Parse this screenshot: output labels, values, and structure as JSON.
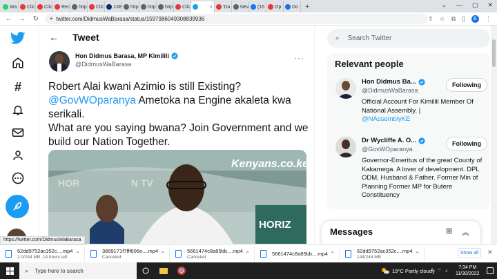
{
  "browser": {
    "tabs": [
      {
        "label": "Wa",
        "color": "#25d366"
      },
      {
        "label": "Clic",
        "color": "#e53935"
      },
      {
        "label": "Clic",
        "color": "#e53935"
      },
      {
        "label": "Rec",
        "color": "#e53935"
      },
      {
        "label": "http",
        "color": "#5f6368"
      },
      {
        "label": "Clic",
        "color": "#e53935"
      },
      {
        "label": "1XE",
        "color": "#0a2a6a"
      },
      {
        "label": "http",
        "color": "#5f6368"
      },
      {
        "label": "http",
        "color": "#5f6368"
      },
      {
        "label": "http",
        "color": "#5f6368"
      },
      {
        "label": "Clic",
        "color": "#e53935"
      },
      {
        "label": "",
        "color": "#1d9bf0",
        "active": true
      },
      {
        "label": "'Da",
        "color": "#e53935"
      },
      {
        "label": "Nev",
        "color": "#5f6368"
      },
      {
        "label": "(15",
        "color": "#1877f2"
      },
      {
        "label": "Op",
        "color": "#e53935"
      },
      {
        "label": "Do",
        "color": "#1a73e8"
      }
    ],
    "url": "twitter.com/DidmusWaBarasa/status/1597986049308839936",
    "profile_initial": "E",
    "status_url": "https://twitter.com/DidmusWaBarasa"
  },
  "tweet_header": {
    "title": "Tweet"
  },
  "author": {
    "name": "Hon Didmus Barasa, MP Kimilili",
    "handle": "@DidmusWaBarasa"
  },
  "tweet": {
    "line1": "Robert Alai kwani Azimio is still Existing?",
    "mention": "@GovWOparanya",
    "line2_rest": " Ametoka na Engine akaleta kwa serikali.",
    "line3": "What are you saying bwana? Join Government and we build our Nation Together.",
    "media_watermark": "Kenyans.co.ke",
    "media_banner1": "HOR",
    "media_banner2": "N TV",
    "media_banner3": "HORIZ"
  },
  "search": {
    "placeholder": "Search Twitter"
  },
  "relevant": {
    "title": "Relevant people",
    "people": [
      {
        "name": "Hon Didmus Ba...",
        "handle": "@DidmusWaBarasa",
        "follow": "Following",
        "bio": "Official Account For Kimilili Member Of National Assembly. |",
        "bio_link": "@NAssemblyKE"
      },
      {
        "name": "Dr Wycliffe A. O...",
        "handle": "@GovWOparanya",
        "follow": "Following",
        "bio": "Governor-Emeritus of the great County of Kakamega. A lover of development. DPL ODM, Husband & Father. Former Min of Planning Former MP for Butere Constituency"
      }
    ]
  },
  "messages": {
    "title": "Messages"
  },
  "downloads": {
    "items": [
      {
        "name": "62dd9752ac352c....mp4",
        "sub": "2.0/244 MB, 14 hours left"
      },
      {
        "name": "3899171f7fff606e....mp4",
        "sub": "Canceled"
      },
      {
        "name": "5661474c8a85bb....mp4",
        "sub": "Canceled"
      },
      {
        "name": "5661474c8a85bb....mp4",
        "sub": ""
      },
      {
        "name": "62dd9752ac352c....mp4",
        "sub": "144/244 MB"
      }
    ],
    "show_all": "Show all"
  },
  "taskbar": {
    "search_placeholder": "Type here to search",
    "weather": "19°C  Partly cloudy",
    "time": "7:34 PM",
    "date": "11/30/2022"
  },
  "colors": {
    "twitter_blue": "#1d9bf0",
    "text": "#0f1419",
    "muted": "#536471"
  }
}
